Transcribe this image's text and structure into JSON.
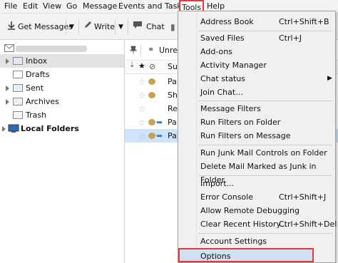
{
  "menubar": {
    "file": "File",
    "edit": "Edit",
    "view": "View",
    "go": "Go",
    "message": "Message",
    "events": "Events and Tasks",
    "tools": "Tools",
    "help": "Help"
  },
  "toolbar": {
    "get_messages": "Get Messages",
    "write": "Write",
    "chat": "Chat"
  },
  "folders": {
    "inbox": "Inbox",
    "drafts": "Drafts",
    "sent": "Sent",
    "archives": "Archives",
    "trash": "Trash",
    "local_folders": "Local Folders"
  },
  "msglist": {
    "filter_label": "Unrea",
    "subject_header": "Su",
    "rows": [
      "Pa",
      "Sh",
      "Re",
      "Pa",
      "Pa"
    ]
  },
  "tools_menu": {
    "address_book": "Address Book",
    "address_book_shortcut": "Ctrl+Shift+B",
    "saved_files": "Saved Files",
    "saved_files_shortcut": "Ctrl+J",
    "addons": "Add-ons",
    "activity_manager": "Activity Manager",
    "chat_status": "Chat status",
    "join_chat": "Join Chat...",
    "message_filters": "Message Filters",
    "run_filters_folder": "Run Filters on Folder",
    "run_filters_message": "Run Filters on Message",
    "run_junk": "Run Junk Mail Controls on Folder",
    "delete_junk": "Delete Mail Marked as Junk in Folder",
    "import": "Import...",
    "error_console": "Error Console",
    "error_console_shortcut": "Ctrl+Shift+J",
    "remote_debugging": "Allow Remote Debugging",
    "clear_history": "Clear Recent History...",
    "clear_history_shortcut": "Ctrl+Shift+Del",
    "account_settings": "Account Settings",
    "options": "Options"
  }
}
